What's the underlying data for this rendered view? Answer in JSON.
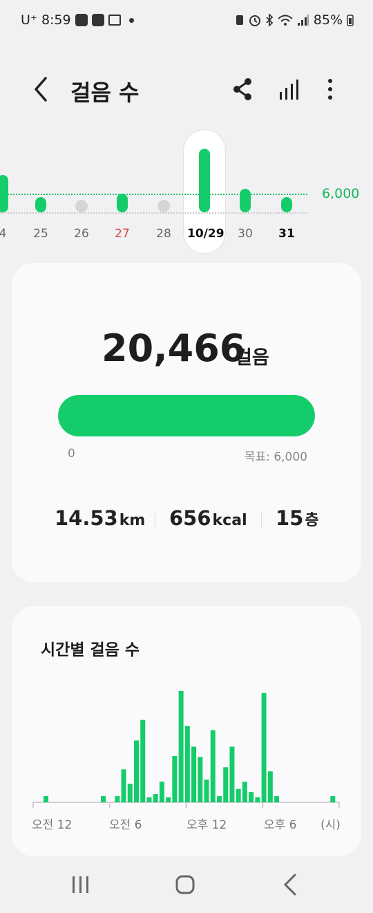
{
  "status": {
    "carrier": "U⁺",
    "time": "8:59",
    "battery": "85%"
  },
  "header": {
    "title": "걸음 수"
  },
  "week": {
    "goal_label": "6,000",
    "days": [
      {
        "label": "4",
        "steps": 12000,
        "color": "#666666"
      },
      {
        "label": "25",
        "steps": 5000,
        "color": "#666666"
      },
      {
        "label": "26",
        "steps": 0,
        "color": "#666666"
      },
      {
        "label": "27",
        "steps": 6000,
        "color": "#d9463a"
      },
      {
        "label": "28",
        "steps": 0,
        "color": "#666666"
      },
      {
        "label": "10/29",
        "steps": 20466,
        "color": "#111111",
        "selected": true
      },
      {
        "label": "30",
        "steps": 7500,
        "color": "#666666"
      },
      {
        "label": "31",
        "steps": 5000,
        "color": "#111111"
      }
    ]
  },
  "summary": {
    "steps": "20,466",
    "steps_unit": "걸음",
    "progress": 1.0,
    "min_label": "0",
    "goal_label": "목표: 6,000",
    "distance": "14.53",
    "distance_unit": "km",
    "calories": "656",
    "calories_unit": "kcal",
    "floors": "15",
    "floors_unit": "층"
  },
  "hourly": {
    "title": "시간별 걸음 수",
    "axis_labels": [
      "오전 12",
      "오전 6",
      "오후 12",
      "오후 6",
      "(시)"
    ],
    "accent": "#14cd6a",
    "chart_data": {
      "type": "bar",
      "x_unit": "시",
      "bars": [
        [
          1.0,
          6
        ],
        [
          5.5,
          6
        ],
        [
          6.6,
          6
        ],
        [
          7.1,
          32
        ],
        [
          7.6,
          18
        ],
        [
          8.1,
          60
        ],
        [
          8.6,
          80
        ],
        [
          9.1,
          5
        ],
        [
          9.6,
          8
        ],
        [
          10.1,
          20
        ],
        [
          10.6,
          5
        ],
        [
          11.1,
          45
        ],
        [
          11.6,
          108
        ],
        [
          12.1,
          74
        ],
        [
          12.6,
          54
        ],
        [
          13.1,
          44
        ],
        [
          13.6,
          22
        ],
        [
          14.1,
          70
        ],
        [
          14.6,
          6
        ],
        [
          15.1,
          34
        ],
        [
          15.6,
          54
        ],
        [
          16.1,
          13
        ],
        [
          16.6,
          20
        ],
        [
          17.1,
          10
        ],
        [
          17.6,
          5
        ],
        [
          18.1,
          106
        ],
        [
          18.6,
          30
        ],
        [
          19.1,
          6
        ],
        [
          23.5,
          6
        ]
      ],
      "ylim": [
        0,
        110
      ]
    }
  }
}
